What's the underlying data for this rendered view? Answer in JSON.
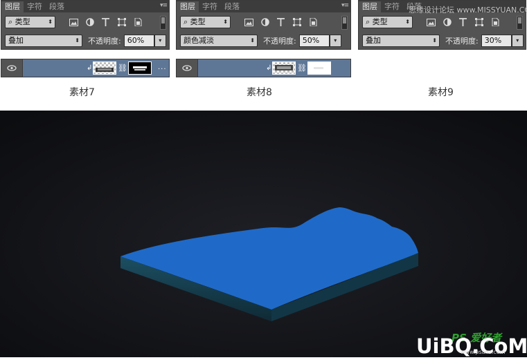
{
  "panels": [
    {
      "tabs": [
        "图层",
        "字符",
        "段落"
      ],
      "filter_kind": "类型",
      "blend_mode": "叠加",
      "opacity_label": "不透明度:",
      "opacity_value": "60%",
      "caption": "素材7"
    },
    {
      "tabs": [
        "图层",
        "字符",
        "段落"
      ],
      "filter_kind": "类型",
      "blend_mode": "颜色减淡",
      "opacity_label": "不透明度:",
      "opacity_value": "50%",
      "caption": "素材8"
    },
    {
      "tabs": [
        "图层",
        "字符",
        "段落"
      ],
      "filter_kind": "类型",
      "blend_mode": "叠加",
      "opacity_label": "不透明度:",
      "opacity_value": "30%",
      "caption": "素材9"
    }
  ],
  "layer_rows": [
    {
      "more": "..."
    },
    {
      "more": "..."
    }
  ],
  "watermarks": {
    "top": "思缘设计论坛 www.MISSYUAN.COM",
    "logo_cn": "PS 爱好者",
    "logo_main": "UiBQ.CoM",
    "logo_sub": "www.psahz.com"
  },
  "colors": {
    "panel_bg": "#535353",
    "selected_layer": "#5f7796",
    "water_top": "#1f6ac8",
    "scene_bg": "#141519"
  }
}
